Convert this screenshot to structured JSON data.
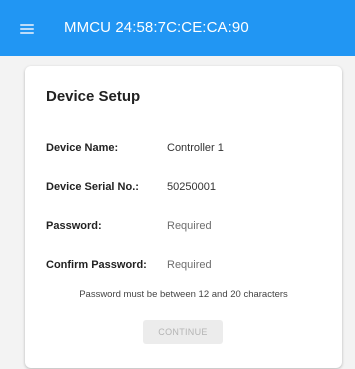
{
  "app_bar": {
    "menu_icon": "hamburger-menu-icon",
    "title": "MMCU 24:58:7C:CE:CA:90",
    "color": "#2196f3"
  },
  "card": {
    "title": "Device Setup",
    "fields": [
      {
        "label": "Device Name:",
        "value": "Controller 1"
      },
      {
        "label": "Device Serial No.:",
        "value": "50250001"
      },
      {
        "label": "Password:",
        "placeholder": "Required"
      },
      {
        "label": "Confirm Password:",
        "placeholder": "Required"
      }
    ],
    "hint": "Password must be between 12 and 20 characters",
    "continue_label": "CONTINUE",
    "continue_enabled": false
  }
}
